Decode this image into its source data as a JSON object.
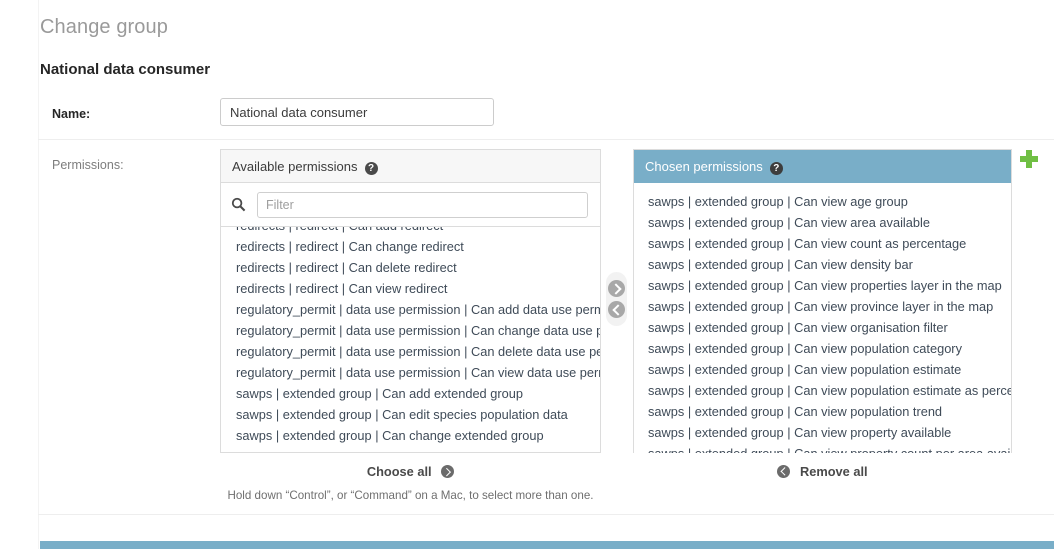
{
  "page": {
    "title": "Change group",
    "object_name": "National data consumer",
    "accent_color": "#79aec8",
    "add_color": "#70bf44"
  },
  "form": {
    "name_label": "Name:",
    "name_value": "National data consumer",
    "permissions_label": "Permissions:"
  },
  "available": {
    "header": "Available permissions",
    "help_glyph": "?",
    "filter_placeholder": "Filter",
    "filter_value": "",
    "search_icon": "search-icon",
    "choose_all_label": "Choose all",
    "help_text": "Hold down “Control”, or “Command” on a Mac, to select more than one.",
    "options": [
      "redirects | redirect | Can add redirect",
      "redirects | redirect | Can change redirect",
      "redirects | redirect | Can delete redirect",
      "redirects | redirect | Can view redirect",
      "regulatory_permit | data use permission | Can add data use permission",
      "regulatory_permit | data use permission | Can change data use permission",
      "regulatory_permit | data use permission | Can delete data use permission",
      "regulatory_permit | data use permission | Can view data use permission",
      "sawps | extended group | Can add extended group",
      "sawps | extended group | Can edit species population data",
      "sawps | extended group | Can change extended group"
    ]
  },
  "chosen": {
    "header": "Chosen permissions",
    "help_glyph": "?",
    "remove_all_label": "Remove all",
    "options": [
      "sawps | extended group | Can view age group",
      "sawps | extended group | Can view area available",
      "sawps | extended group | Can view count as percentage",
      "sawps | extended group | Can view density bar",
      "sawps | extended group | Can view properties layer in the map",
      "sawps | extended group | Can view province layer in the map",
      "sawps | extended group | Can view organisation filter",
      "sawps | extended group | Can view population category",
      "sawps | extended group | Can view population estimate",
      "sawps | extended group | Can view population estimate as percentage",
      "sawps | extended group | Can view population trend",
      "sawps | extended group | Can view property available",
      "sawps | extended group | Can view property count per area available"
    ]
  },
  "arrows": {
    "choose_icon": "arrow-right-circle-icon",
    "remove_icon": "arrow-left-circle-icon"
  }
}
